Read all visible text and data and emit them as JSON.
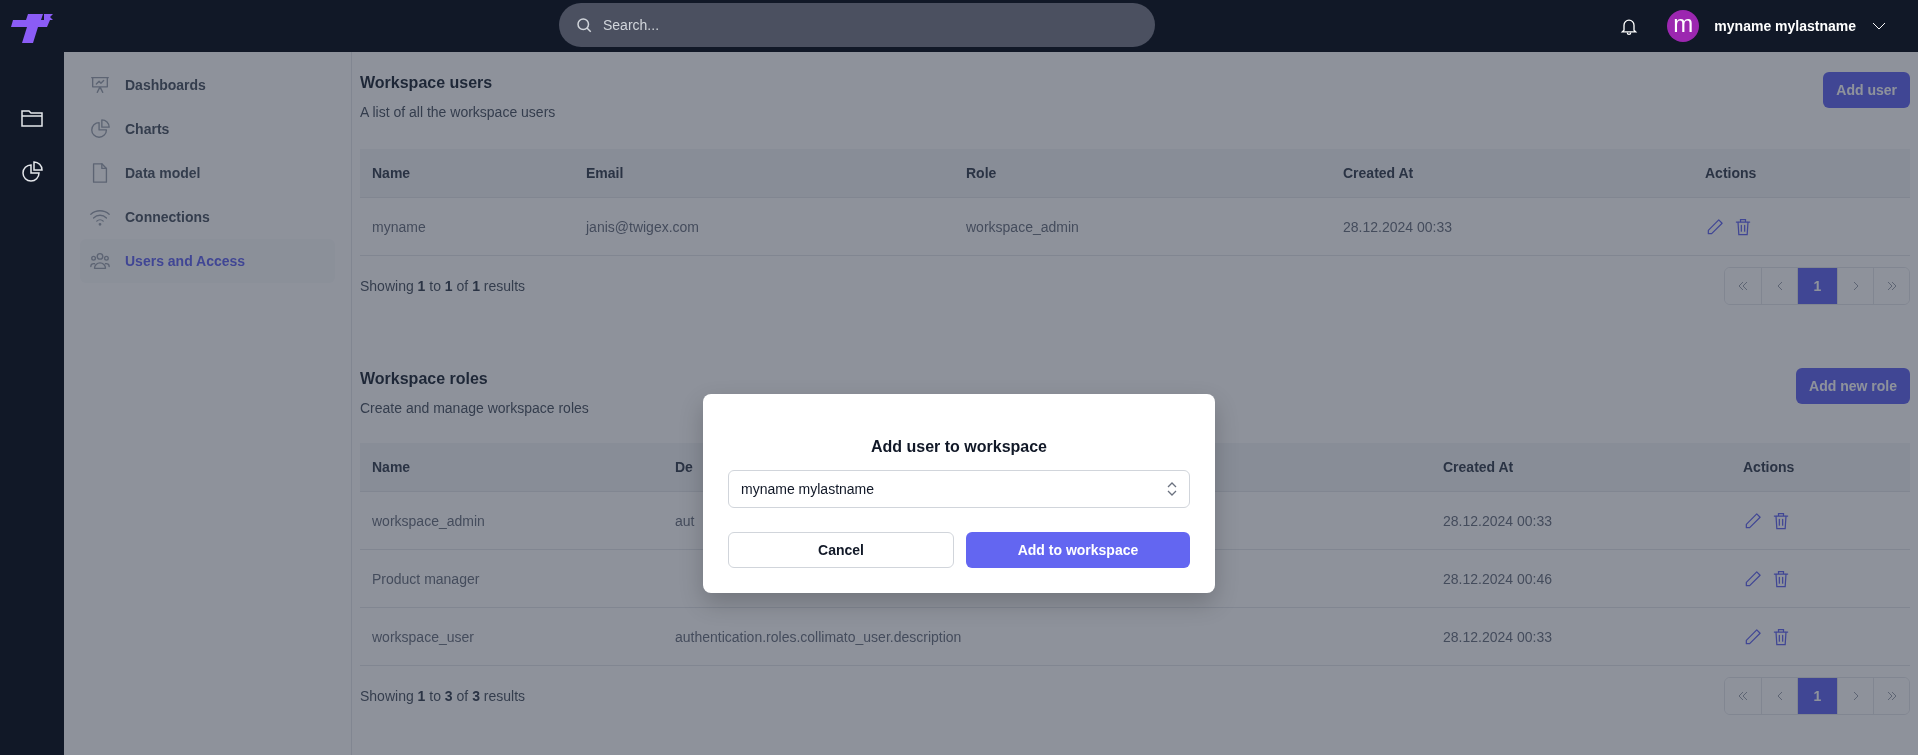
{
  "topbar": {
    "search": {
      "placeholder": "Search..."
    },
    "user": {
      "avatar_letter": "m",
      "name": "myname mylastname"
    }
  },
  "sidebar": {
    "items": [
      {
        "label": "Dashboards",
        "kind": "easel",
        "selected": false
      },
      {
        "label": "Charts",
        "kind": "pie",
        "selected": false
      },
      {
        "label": "Data model",
        "kind": "file",
        "selected": false
      },
      {
        "label": "Connections",
        "kind": "wifi",
        "selected": false
      },
      {
        "label": "Users and Access",
        "kind": "people",
        "selected": true
      }
    ]
  },
  "users_section": {
    "title": "Workspace users",
    "subtitle": "A list of all the workspace users",
    "add_button": "Add user",
    "table": {
      "columns": [
        "Name",
        "Email",
        "Role",
        "Created At",
        "Actions"
      ],
      "rows": [
        {
          "cells": [
            "myname",
            "janis@twigex.com",
            "workspace_admin",
            "28.12.2024 00:33"
          ]
        }
      ]
    },
    "summary": "Showing **1** to **1** of **1** results",
    "pagination": {
      "pages": [
        {
          "label": "1",
          "selected": true
        }
      ]
    }
  },
  "roles_section": {
    "title": "Workspace roles",
    "subtitle": "Create and manage workspace roles",
    "add_button": "Add new role",
    "table": {
      "columns": [
        "Name",
        "De",
        "Created At",
        "Actions"
      ],
      "rows": [
        {
          "cells": [
            "workspace_admin",
            "aut",
            "28.12.2024 00:33"
          ]
        },
        {
          "cells": [
            "Product manager",
            null,
            "28.12.2024 00:46"
          ]
        },
        {
          "cells": [
            "workspace_user",
            "authentication.roles.collimato_user.description",
            "28.12.2024 00:33"
          ]
        }
      ]
    },
    "summary": "Showing **1** to **3** of **3** results",
    "pagination": {
      "pages": [
        {
          "label": "1",
          "selected": true
        }
      ]
    }
  },
  "dialog": {
    "title": "Add user to workspace",
    "select": {
      "value": "myname mylastname"
    },
    "buttons": [
      {
        "label": "Cancel",
        "kind": "secondary"
      },
      {
        "label": "Add to workspace",
        "kind": "primary"
      }
    ]
  }
}
